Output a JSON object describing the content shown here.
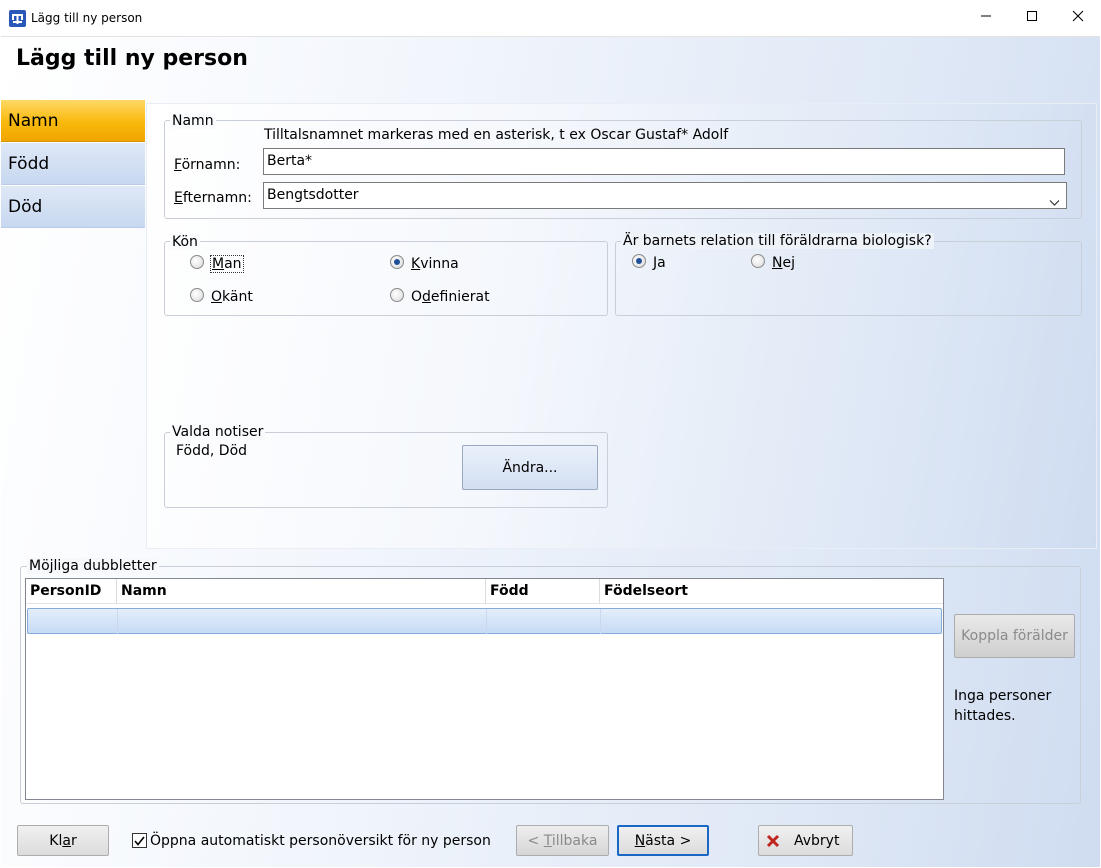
{
  "window": {
    "title": "Lägg till ny person"
  },
  "header": {
    "title": "Lägg till ny person"
  },
  "nav": {
    "items": [
      {
        "label": "Namn",
        "active": true
      },
      {
        "label": "Född",
        "active": false
      },
      {
        "label": "Död",
        "active": false
      }
    ]
  },
  "name_group": {
    "legend": "Namn",
    "hint": "Tilltalsnamnet markeras med en asterisk, t ex  Oscar Gustaf* Adolf",
    "first_name_label": "Förnamn:",
    "first_name_value": "Berta*",
    "last_name_label": "Efternamn:",
    "last_name_value": "Bengtsdotter"
  },
  "gender_group": {
    "legend": "Kön",
    "options": [
      {
        "label": "Man",
        "checked": false
      },
      {
        "label": "Kvinna",
        "checked": true
      },
      {
        "label": "Okänt",
        "checked": false
      },
      {
        "label": "Odefinierat",
        "checked": false
      }
    ]
  },
  "bio_group": {
    "legend": "Är barnets relation till föräldrarna biologisk?",
    "options": [
      {
        "label": "Ja",
        "checked": true
      },
      {
        "label": "Nej",
        "checked": false
      }
    ]
  },
  "notices_group": {
    "legend": "Valda notiser",
    "value": "Född, Död",
    "change_button": "Ändra..."
  },
  "duplicates": {
    "legend": "Möjliga dubbletter",
    "columns": [
      "PersonID",
      "Namn",
      "Född",
      "Födelseort"
    ],
    "connect_button": "Koppla förälder",
    "status": "Inga personer hittades."
  },
  "footer": {
    "ready_button": "Klar",
    "auto_open_label": "Öppna automatiskt personöversikt för ny person",
    "auto_open_checked": true,
    "back_button": "< Tillbaka",
    "next_button": "Nästa >",
    "cancel_button": "Avbryt"
  },
  "colors": {
    "nav_active": "#f9b80c",
    "nav_normal": "#c7d8f0",
    "cancel_icon": "#c0261d"
  }
}
